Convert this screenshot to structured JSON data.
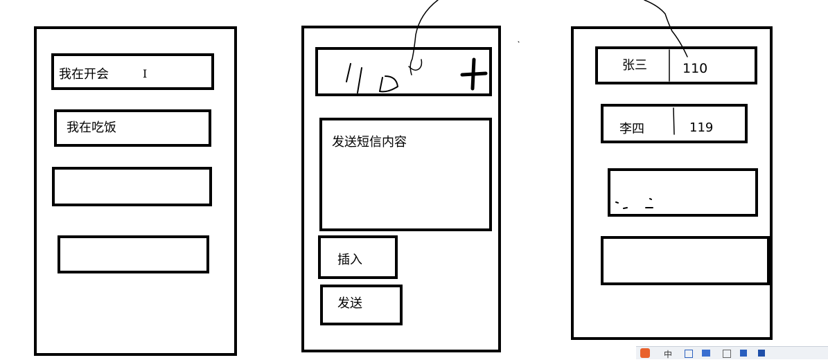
{
  "panel_left": {
    "items": [
      "我在开会",
      "我在吃饭",
      "",
      ""
    ],
    "cursor_glyph": "I"
  },
  "panel_middle": {
    "recipient_input": {
      "handwriting": "110",
      "add_button": "+"
    },
    "message_box": {
      "text": "发送短信内容"
    },
    "insert_button": "插入",
    "send_button": "发送"
  },
  "panel_right": {
    "contacts": [
      {
        "name": "张三",
        "number": "110"
      },
      {
        "name": "李四",
        "number": "119"
      },
      {
        "name": "",
        "number": ""
      },
      {
        "name": "",
        "number": ""
      }
    ]
  },
  "taskbar": {
    "ime_label": "中"
  },
  "colors": {
    "stroke": "#000000",
    "background": "#ffffff",
    "ime_accent": "#e8612c"
  }
}
